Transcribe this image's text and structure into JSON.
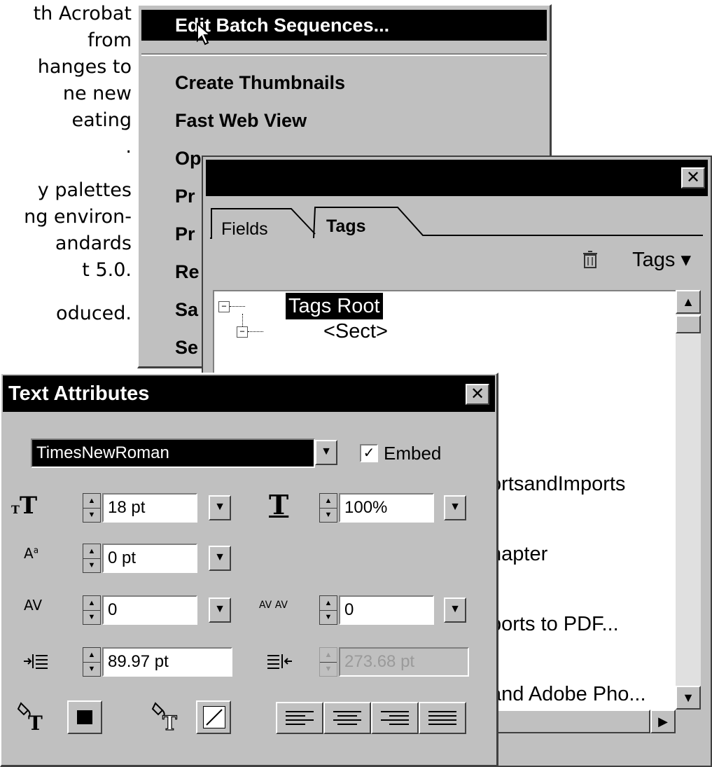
{
  "background_text": {
    "lines": [
      "th Acrobat",
      "from",
      "hanges to",
      "ne new",
      "eating",
      ".",
      "y palettes",
      "ng environ-",
      "andards",
      "t 5.0.",
      "oduced."
    ]
  },
  "batch_menu": {
    "items": [
      "Edit Batch Sequences...",
      "Create Thumbnails",
      "Fast Web View",
      "Op",
      "Pr",
      "Pr",
      "Re",
      "Sa",
      "Se"
    ]
  },
  "tags_palette": {
    "close_glyph": "✕",
    "tabs": [
      "Fields",
      "Tags"
    ],
    "options_label": "Tags ▾",
    "tree": [
      "Tags Root",
      "<Sect>",
      "ortsandImports",
      "hapter",
      "ports to PDF...",
      "and Adobe Pho..."
    ]
  },
  "text_attributes": {
    "title": "Text Attributes",
    "close_glyph": "✕",
    "font": "TimesNewRoman",
    "embed_label": "Embed",
    "embed_checked": true,
    "font_size": "18 pt",
    "horizontal_scale": "100%",
    "baseline_shift": "0 pt",
    "tracking": "0",
    "word_spacing": "0",
    "left_indent": "89.97 pt",
    "right_indent": "273.68 pt",
    "icons": {
      "font_size": "font-size-icon",
      "horizontal_scale": "horizontal-scale-icon",
      "baseline_shift": "baseline-shift-icon",
      "tracking": "tracking-icon",
      "word_spacing": "word-spacing-icon",
      "left_indent": "left-indent-icon",
      "right_indent": "right-indent-icon",
      "fill_color": "fill-color-icon",
      "stroke_color": "stroke-color-icon"
    }
  }
}
